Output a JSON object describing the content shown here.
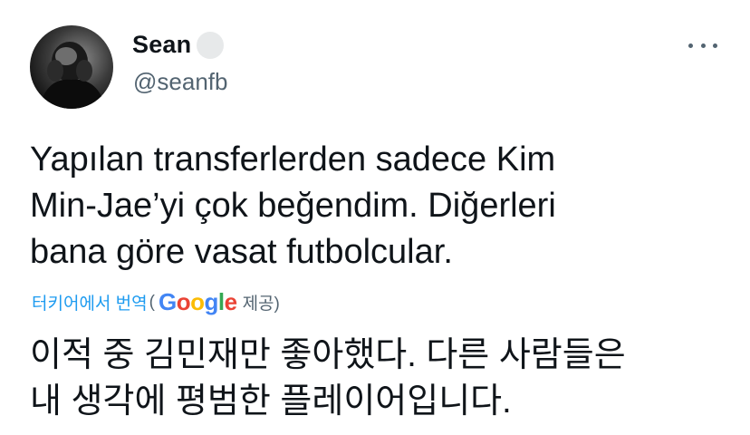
{
  "author": {
    "display_name": "Sean",
    "handle": "@seanfb",
    "avatar_icon": "profile-photo"
  },
  "menu": {
    "icon": "more-options-icon"
  },
  "tweet": {
    "lines": [
      "Yapılan transferlerden sadece Kim",
      "Min-Jae’yi çok beğendim. Diğerleri",
      "bana göre vasat futbolcular."
    ]
  },
  "translation": {
    "link_label": "터키어에서 번역",
    "open_paren": "(",
    "provider_letters": [
      "G",
      "o",
      "o",
      "g",
      "l",
      "e"
    ],
    "provided_suffix": "제공)",
    "lines": [
      "이적 중 김민재만 좋아했다. 다른 사람들은",
      "내 생각에 평범한 플레이어입니다."
    ]
  },
  "colors": {
    "text": "#0f1419",
    "secondary": "#536471",
    "link": "#1d9bf0"
  }
}
